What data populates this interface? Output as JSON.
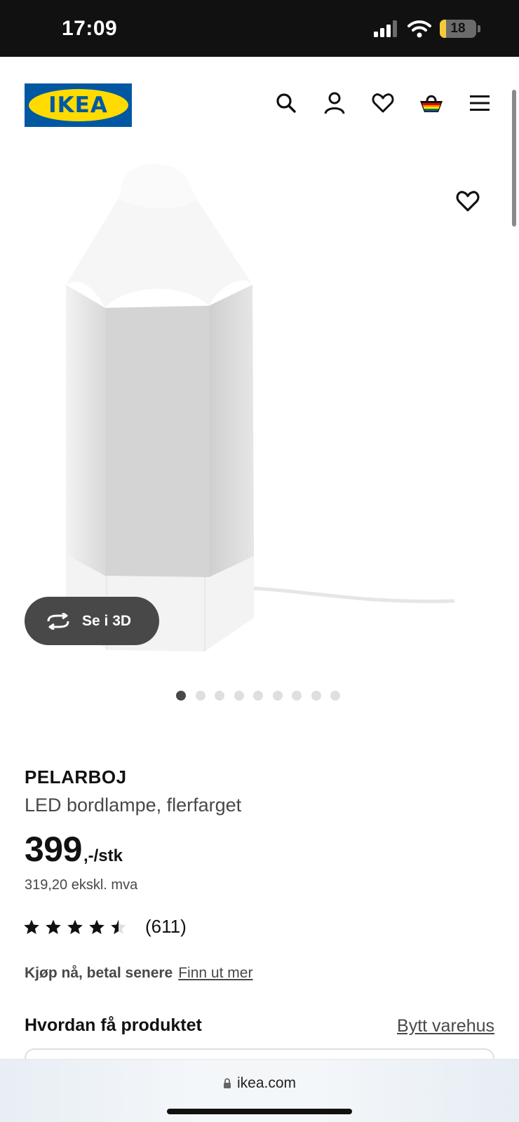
{
  "status_bar": {
    "time": "17:09",
    "battery_level": "18",
    "battery_fraction": 0.18
  },
  "header": {
    "logo_text": "IKEA",
    "icons": [
      "search-icon",
      "account-icon",
      "favorites-icon",
      "basket-icon",
      "menu-icon"
    ]
  },
  "gallery": {
    "see_3d_label": "Se i 3D",
    "image_count": 9,
    "active_index": 0
  },
  "product": {
    "name": "PELARBOJ",
    "description": "LED bordlampe, flerfarget",
    "price": "399",
    "price_suffix": ",-/stk",
    "price_excl_vat": "319,20 ekskl. mva",
    "rating": 4.5,
    "review_count": "(611)",
    "bnpl_text": "Kjøp nå, betal senere",
    "bnpl_link": "Finn ut mer"
  },
  "delivery": {
    "title": "Hvordan få produktet",
    "change_store_link": "Bytt varehus"
  },
  "browser": {
    "url": "ikea.com"
  },
  "colors": {
    "brand_blue": "#0058a3",
    "brand_yellow": "#ffdb00",
    "button_dark": "#484848"
  }
}
